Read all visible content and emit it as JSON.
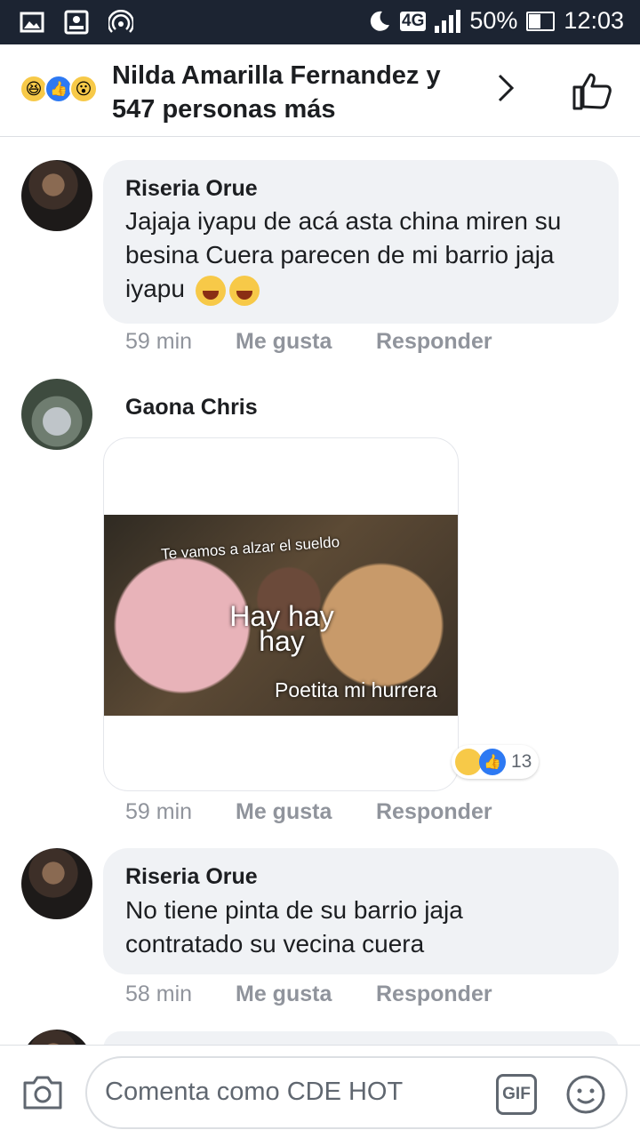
{
  "status_bar": {
    "network": "4G",
    "battery": "50%",
    "battery_fill": 0.5,
    "time": "12:03"
  },
  "header": {
    "title": "Nilda Amarilla Fernandez y 547 personas más",
    "reaction_icons": [
      "haha-icon",
      "like-icon",
      "wow-icon"
    ]
  },
  "comments": [
    {
      "name": "Riseria Orue",
      "text": "Jajaja iyapu de acá asta china miren su besina Cuera parecen de mi barrio jaja iyapu",
      "time": "59 min",
      "like": "Me gusta",
      "reply": "Responder"
    },
    {
      "name": "Gaona Chris",
      "meme": {
        "top_text": "Te vamos a alzar el sueldo",
        "middle_text": "Hay hay hay",
        "bottom_text": "Poetita mi hurrera"
      },
      "reaction_count": "13",
      "time": "59 min",
      "like": "Me gusta",
      "reply": "Responder"
    },
    {
      "name": "Riseria Orue",
      "text": "No tiene pinta de su barrio jaja contratado su vecina cuera",
      "time": "58 min",
      "like": "Me gusta",
      "reply": "Responder"
    }
  ],
  "composer": {
    "placeholder": "Comenta como CDE HOT",
    "gif_label": "GIF"
  },
  "colors": {
    "status_bar_bg": "#1c2432",
    "like_blue": "#2d79f3",
    "bubble_bg": "#f0f2f5",
    "meta_grey": "#90949c"
  }
}
